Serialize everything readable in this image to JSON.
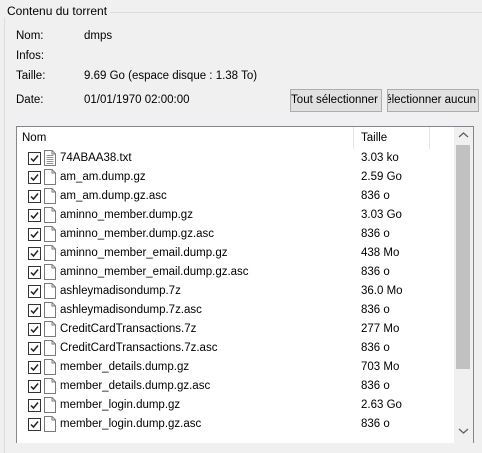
{
  "group_title": "Contenu du torrent",
  "info": {
    "name_label": "Nom:",
    "name_value": "dmps",
    "infos_label": "Infos:",
    "infos_value": "",
    "size_label": "Taille:",
    "size_value": "9.69 Go (espace disque : 1.38 To)",
    "date_label": "Date:",
    "date_value": "01/01/1970 02:00:00"
  },
  "buttons": {
    "select_all": "Tout sélectionner",
    "deselect_all": "Désélectionner aucun"
  },
  "list": {
    "columns": {
      "name": "Nom",
      "size": "Taille"
    },
    "rows": [
      {
        "name": "74ABAA38.txt",
        "size": "3.03 ko",
        "checked": true
      },
      {
        "name": "am_am.dump.gz",
        "size": "2.59 Go",
        "checked": true
      },
      {
        "name": "am_am.dump.gz.asc",
        "size": "836 o",
        "checked": true
      },
      {
        "name": "aminno_member.dump.gz",
        "size": "3.03 Go",
        "checked": true
      },
      {
        "name": "aminno_member.dump.gz.asc",
        "size": "836 o",
        "checked": true
      },
      {
        "name": "aminno_member_email.dump.gz",
        "size": "438 Mo",
        "checked": true
      },
      {
        "name": "aminno_member_email.dump.gz.asc",
        "size": "836 o",
        "checked": true
      },
      {
        "name": "ashleymadisondump.7z",
        "size": "36.0 Mo",
        "checked": true
      },
      {
        "name": "ashleymadisondump.7z.asc",
        "size": "836 o",
        "checked": true
      },
      {
        "name": "CreditCardTransactions.7z",
        "size": "277 Mo",
        "checked": true
      },
      {
        "name": "CreditCardTransactions.7z.asc",
        "size": "836 o",
        "checked": true
      },
      {
        "name": "member_details.dump.gz",
        "size": "703 Mo",
        "checked": true
      },
      {
        "name": "member_details.dump.gz.asc",
        "size": "836 o",
        "checked": true
      },
      {
        "name": "member_login.dump.gz",
        "size": "2.63 Go",
        "checked": true
      },
      {
        "name": "member_login.dump.gz.asc",
        "size": "836 o",
        "checked": true
      }
    ]
  }
}
